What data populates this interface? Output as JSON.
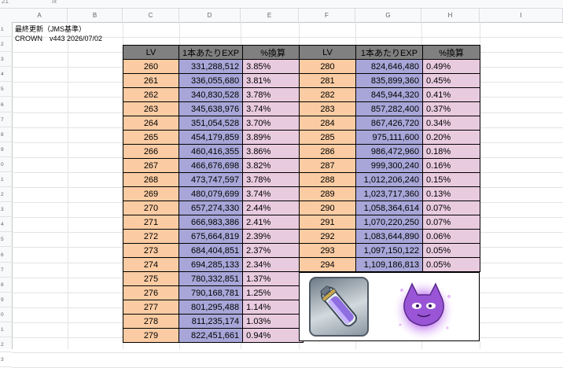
{
  "toolbar": {
    "name_box": "21",
    "fx_label": "fx"
  },
  "columns": [
    "A",
    "B",
    "C",
    "D",
    "E",
    "F",
    "G",
    "H",
    "I"
  ],
  "rows": [
    "1",
    "2",
    "3",
    "4",
    "5",
    "6",
    "7",
    "8",
    "9",
    "0",
    "1",
    "2",
    "3",
    "4",
    "5",
    "6",
    "7",
    "8",
    "9",
    "0",
    "1",
    "2",
    "3"
  ],
  "notes": {
    "line1": "最終更新（JMS基準）",
    "line2": "CROWN　v443 2026/07/02"
  },
  "table": {
    "headers": [
      "LV",
      "1本あたりEXP",
      "%換算",
      "LV",
      "1本あたりEXP",
      "%換算"
    ],
    "left_rows": [
      [
        "260",
        "331,288,512",
        "3.85%"
      ],
      [
        "261",
        "336,055,680",
        "3.81%"
      ],
      [
        "262",
        "340,830,528",
        "3.78%"
      ],
      [
        "263",
        "345,638,976",
        "3.74%"
      ],
      [
        "264",
        "351,054,528",
        "3.70%"
      ],
      [
        "265",
        "454,179,859",
        "3.89%"
      ],
      [
        "266",
        "460,416,355",
        "3.86%"
      ],
      [
        "267",
        "466,676,698",
        "3.82%"
      ],
      [
        "268",
        "473,747,597",
        "3.78%"
      ],
      [
        "269",
        "480,079,699",
        "3.74%"
      ],
      [
        "270",
        "657,274,330",
        "2.44%"
      ],
      [
        "271",
        "666,983,386",
        "2.41%"
      ],
      [
        "272",
        "675,664,819",
        "2.39%"
      ],
      [
        "273",
        "684,404,851",
        "2.37%"
      ],
      [
        "274",
        "694,285,133",
        "2.34%"
      ],
      [
        "275",
        "780,332,851",
        "1.37%"
      ],
      [
        "276",
        "790,168,781",
        "1.25%"
      ],
      [
        "277",
        "801,295,488",
        "1.14%"
      ],
      [
        "278",
        "811,235,174",
        "1.03%"
      ],
      [
        "279",
        "822,451,661",
        "0.94%"
      ]
    ],
    "right_rows": [
      [
        "280",
        "824,646,480",
        "0.49%"
      ],
      [
        "281",
        "835,899,360",
        "0.45%"
      ],
      [
        "282",
        "845,944,320",
        "0.41%"
      ],
      [
        "283",
        "857,282,400",
        "0.37%"
      ],
      [
        "284",
        "867,426,720",
        "0.34%"
      ],
      [
        "285",
        "975,111,600",
        "0.20%"
      ],
      [
        "286",
        "986,472,960",
        "0.18%"
      ],
      [
        "287",
        "999,300,240",
        "0.16%"
      ],
      [
        "288",
        "1,012,206,240",
        "0.15%"
      ],
      [
        "289",
        "1,023,717,360",
        "0.13%"
      ],
      [
        "290",
        "1,058,364,614",
        "0.07%"
      ],
      [
        "291",
        "1,070,220,250",
        "0.07%"
      ],
      [
        "292",
        "1,083,644,890",
        "0.06%"
      ],
      [
        "293",
        "1,097,150,122",
        "0.05%"
      ],
      [
        "294",
        "1,109,186,813",
        "0.05%"
      ]
    ]
  },
  "colors": {
    "header_bg": "#808080",
    "lv_bg": "#fbcca3",
    "exp_bg": "#a8a6d8",
    "pct_bg": "#e9cbe0"
  },
  "images": {
    "item1_icon": "exp-potion-icon",
    "item2_icon": "purple-cat-spirit-icon"
  }
}
